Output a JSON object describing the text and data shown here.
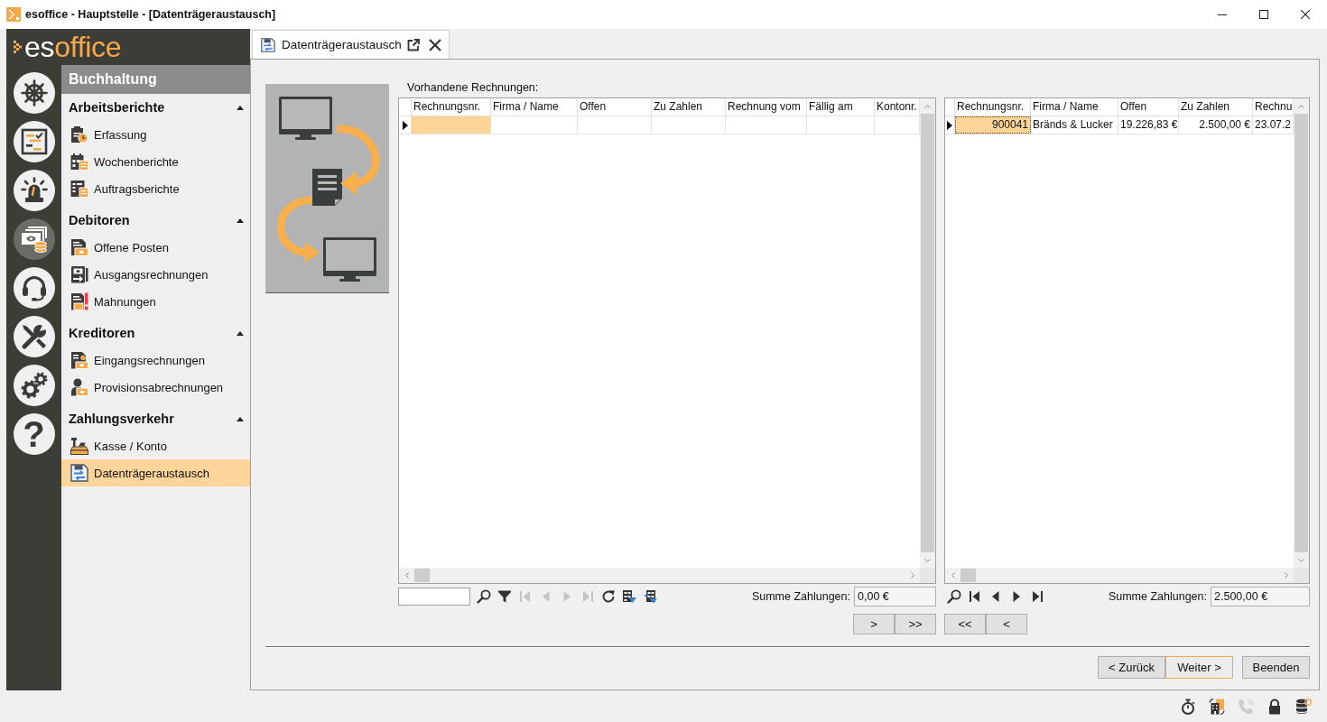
{
  "window": {
    "title": "esoffice - Hauptstelle - [Datenträgeraustausch]"
  },
  "logo": {
    "parts": [
      "es",
      "office"
    ]
  },
  "modules": [
    {
      "kind": "helm",
      "selected": false
    },
    {
      "kind": "planner",
      "selected": false
    },
    {
      "kind": "alarm",
      "selected": false
    },
    {
      "kind": "money",
      "selected": true
    },
    {
      "kind": "headset",
      "selected": false
    },
    {
      "kind": "tools",
      "selected": false
    },
    {
      "kind": "gears",
      "selected": false
    },
    {
      "kind": "help",
      "glyph": "?",
      "selected": false
    }
  ],
  "nav": {
    "title": "Buchhaltung",
    "sections": [
      {
        "label": "Arbeitsberichte",
        "expanded": true,
        "items": [
          {
            "label": "Erfassung",
            "kind": "clipboard-clock",
            "selected": false
          },
          {
            "label": "Wochenberichte",
            "kind": "calendar",
            "selected": false
          },
          {
            "label": "Auftragsberichte",
            "kind": "report",
            "selected": false
          }
        ]
      },
      {
        "label": "Debitoren",
        "expanded": true,
        "items": [
          {
            "label": "Offene Posten",
            "kind": "document-money",
            "selected": false
          },
          {
            "label": "Ausgangsrechnungen",
            "kind": "document-arrow",
            "selected": false
          },
          {
            "label": "Mahnungen",
            "kind": "document-alert",
            "selected": false
          }
        ]
      },
      {
        "label": "Kreditoren",
        "expanded": true,
        "items": [
          {
            "label": "Eingangsrechnungen",
            "kind": "document-person",
            "selected": false
          },
          {
            "label": "Provisionsabrechnungen",
            "kind": "person-money",
            "selected": false
          }
        ]
      },
      {
        "label": "Zahlungsverkehr",
        "expanded": true,
        "items": [
          {
            "label": "Kasse / Konto",
            "kind": "cash-register",
            "selected": false
          },
          {
            "label": "Datenträgeraustausch",
            "kind": "floppy-arrows",
            "selected": true
          }
        ]
      }
    ]
  },
  "tabs": [
    {
      "label": "Datenträgeraustausch",
      "selected": true
    }
  ],
  "panels": [
    {
      "caption": "Vorhandene Rechnungen:",
      "focused": false,
      "columns": [
        {
          "label": "Rechnungsnr.",
          "kind": "number"
        },
        {
          "label": "Firma / Name",
          "kind": "text"
        },
        {
          "label": "Offen",
          "kind": "number"
        },
        {
          "label": "Zu Zahlen",
          "kind": "number"
        },
        {
          "label": "Rechnung vom",
          "kind": "text"
        },
        {
          "label": "Fällig am",
          "kind": "text"
        },
        {
          "label": "Kontonr.",
          "kind": "text"
        }
      ],
      "rows": [
        {
          "current": true
        }
      ],
      "tools": [
        {
          "kind": "search-field",
          "disabled": false
        },
        {
          "kind": "search",
          "disabled": false
        },
        {
          "kind": "filter",
          "disabled": false
        },
        {
          "kind": "first",
          "disabled": true
        },
        {
          "kind": "previous",
          "disabled": true
        },
        {
          "kind": "next",
          "disabled": true
        },
        {
          "kind": "last",
          "disabled": true
        },
        {
          "kind": "refresh",
          "disabled": false
        },
        {
          "kind": "table-export",
          "disabled": false
        },
        {
          "kind": "table-import",
          "disabled": false
        }
      ],
      "sum": {
        "label": "Summe Zahlungen:",
        "value": "0,00 €"
      },
      "move_buttons": [
        ">",
        ">>"
      ]
    },
    {
      "focused": true,
      "columns": [
        {
          "label": "Rechnungsnr.",
          "kind": "number"
        },
        {
          "label": "Firma / Name",
          "kind": "text"
        },
        {
          "label": "Offen",
          "kind": "number"
        },
        {
          "label": "Zu Zahlen",
          "kind": "number"
        },
        {
          "label": "Rechnu",
          "kind": "text"
        }
      ],
      "rows": [
        {
          "current": true,
          "cells": [
            "900041",
            "Bränds & Lucker",
            "19.226,83 €",
            "2.500,00 €",
            "23.07.2"
          ]
        }
      ],
      "tools": [
        {
          "kind": "search",
          "disabled": false
        },
        {
          "kind": "first",
          "disabled": false
        },
        {
          "kind": "previous",
          "disabled": false
        },
        {
          "kind": "next",
          "disabled": false
        },
        {
          "kind": "last",
          "disabled": false
        }
      ],
      "sum": {
        "label": "Summe Zahlungen:",
        "value": "2.500,00 €"
      },
      "move_buttons": [
        "<<",
        "<"
      ]
    }
  ],
  "footer_buttons": [
    {
      "label": "< Zurück",
      "default": false
    },
    {
      "label": "Weiter >",
      "default": true
    },
    {
      "label": "Beenden",
      "default": false
    }
  ],
  "status_icons": [
    {
      "kind": "stopwatch",
      "disabled": false
    },
    {
      "kind": "building",
      "disabled": false
    },
    {
      "kind": "phone",
      "disabled": true
    },
    {
      "kind": "lock",
      "disabled": false
    },
    {
      "kind": "database",
      "disabled": false
    }
  ]
}
